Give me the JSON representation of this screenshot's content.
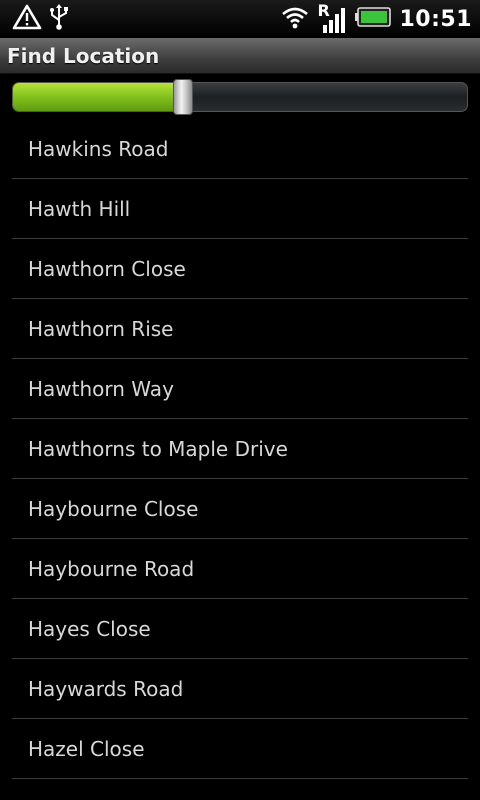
{
  "status_bar": {
    "icons": [
      "warning-icon",
      "usb-icon",
      "wifi-icon",
      "roaming-signal-icon",
      "battery-icon"
    ],
    "roaming_indicator": "R",
    "time": "10:51",
    "battery_color": "#3cc43c"
  },
  "title_bar": {
    "title": "Find Location"
  },
  "slider": {
    "value_fraction": 0.375,
    "accent_color": "#86c41f"
  },
  "locations": [
    "Hawkins Road",
    "Hawth Hill",
    "Hawthorn Close",
    "Hawthorn Rise",
    "Hawthorn Way",
    "Hawthorns to Maple Drive",
    "Haybourne Close",
    "Haybourne Road",
    "Hayes Close",
    "Haywards Road",
    "Hazel Close"
  ]
}
